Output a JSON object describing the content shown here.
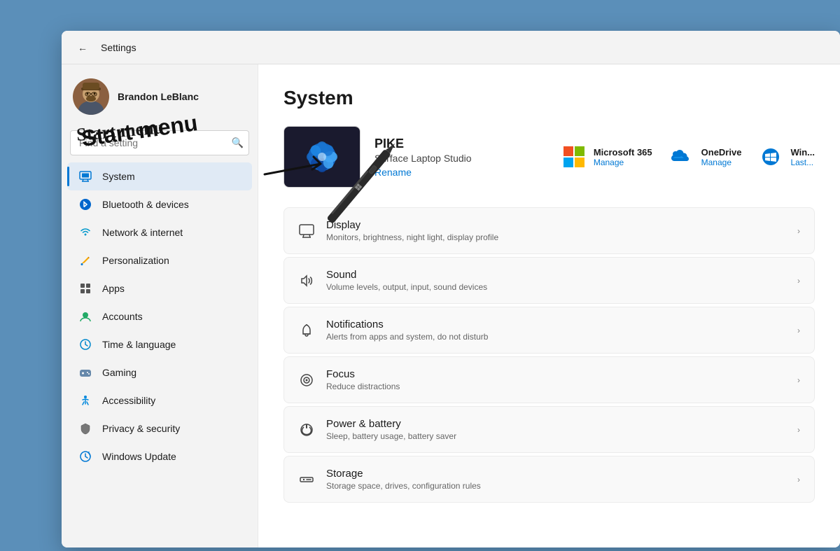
{
  "window": {
    "title": "Settings",
    "back_label": "←"
  },
  "sidebar": {
    "user": {
      "name": "Brandon LeBlanc"
    },
    "search": {
      "placeholder": "Find a setting",
      "value": ""
    },
    "nav_items": [
      {
        "id": "system",
        "label": "System",
        "icon": "monitor",
        "active": true
      },
      {
        "id": "bluetooth",
        "label": "Bluetooth & devices",
        "icon": "bluetooth",
        "active": false
      },
      {
        "id": "network",
        "label": "Network & internet",
        "icon": "network",
        "active": false
      },
      {
        "id": "personalization",
        "label": "Personalization",
        "icon": "paint",
        "active": false
      },
      {
        "id": "apps",
        "label": "Apps",
        "icon": "apps",
        "active": false
      },
      {
        "id": "accounts",
        "label": "Accounts",
        "icon": "account",
        "active": false
      },
      {
        "id": "time",
        "label": "Time & language",
        "icon": "time",
        "active": false
      },
      {
        "id": "gaming",
        "label": "Gaming",
        "icon": "gaming",
        "active": false
      },
      {
        "id": "accessibility",
        "label": "Accessibility",
        "icon": "accessibility",
        "active": false
      },
      {
        "id": "privacy",
        "label": "Privacy & security",
        "icon": "privacy",
        "active": false
      },
      {
        "id": "windowsupdate",
        "label": "Windows Update",
        "icon": "update",
        "active": false
      }
    ]
  },
  "main": {
    "page_title": "System",
    "device": {
      "name": "PIKE",
      "model": "Surface Laptop Studio",
      "rename_label": "Rename"
    },
    "quick_links": [
      {
        "id": "ms365",
        "title": "Microsoft 365",
        "sub": "Manage"
      },
      {
        "id": "onedrive",
        "title": "OneDrive",
        "sub": "Manage"
      },
      {
        "id": "windows",
        "title": "Win...",
        "sub": "Last..."
      }
    ],
    "settings_items": [
      {
        "id": "display",
        "icon": "display",
        "title": "Display",
        "desc": "Monitors, brightness, night light, display profile"
      },
      {
        "id": "sound",
        "icon": "sound",
        "title": "Sound",
        "desc": "Volume levels, output, input, sound devices"
      },
      {
        "id": "notifications",
        "icon": "notifications",
        "title": "Notifications",
        "desc": "Alerts from apps and system, do not disturb"
      },
      {
        "id": "focus",
        "icon": "focus",
        "title": "Focus",
        "desc": "Reduce distractions"
      },
      {
        "id": "power",
        "icon": "power",
        "title": "Power & battery",
        "desc": "Sleep, battery usage, battery saver"
      },
      {
        "id": "storage",
        "icon": "storage",
        "title": "Storage",
        "desc": "Storage space, drives, configuration rules"
      }
    ]
  },
  "annotation": {
    "text": "Start menu"
  }
}
